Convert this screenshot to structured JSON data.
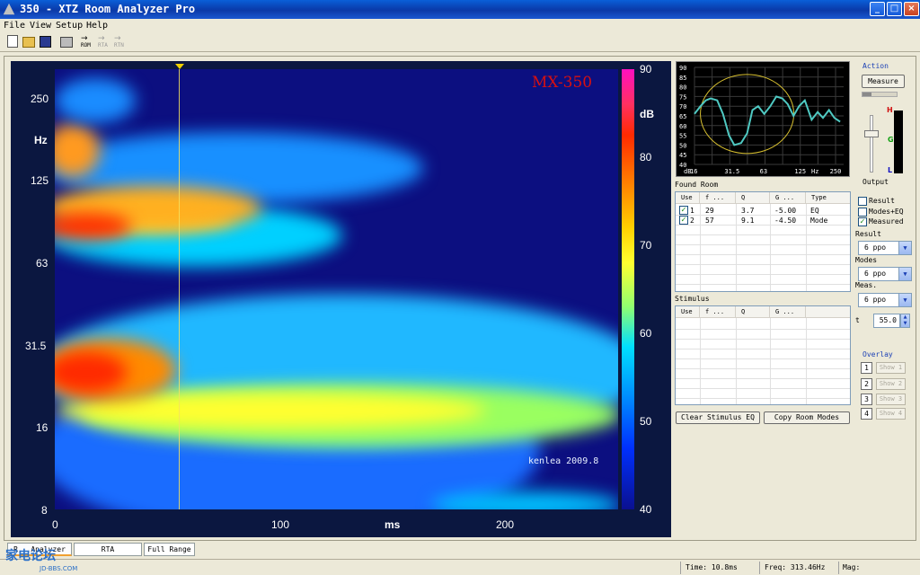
{
  "window": {
    "title": "350 - XTZ Room Analyzer Pro"
  },
  "menu": [
    "File",
    "View",
    "Setup",
    "Help"
  ],
  "toolbar": {
    "rom_label": "ROM",
    "rta_label": "RTA",
    "rtn_label": "RTN"
  },
  "spectrogram": {
    "overlay_title": "MX-350",
    "y_unit": "Hz",
    "y_ticks": [
      "250",
      "125",
      "63",
      "31.5",
      "16",
      "8"
    ],
    "x_ticks": [
      "0",
      "100",
      "200"
    ],
    "x_unit": "ms",
    "colorbar_ticks": [
      "90",
      "80",
      "70",
      "60",
      "50",
      "40"
    ],
    "colorbar_unit": "dB",
    "watermark": "kenlea 2009.8",
    "colors": {
      "background": "#0b1740",
      "cursor": "#f0d000"
    }
  },
  "chart_data": {
    "type": "line",
    "x_ticks": [
      "16",
      "31.5",
      "63",
      "125",
      "250"
    ],
    "y_ticks": [
      "90",
      "85",
      "80",
      "75",
      "70",
      "65",
      "60",
      "55",
      "50",
      "45",
      "40"
    ],
    "y_unit": "dB",
    "x_unit": "Hz",
    "ylim": [
      40,
      90
    ],
    "x": [
      16,
      18,
      20,
      22,
      25,
      28,
      31.5,
      35,
      40,
      45,
      50,
      56,
      63,
      71,
      80,
      90,
      100,
      112,
      125,
      140,
      160,
      180,
      200,
      225,
      250,
      280
    ],
    "values": [
      66,
      70,
      73,
      74,
      73,
      66,
      55,
      50,
      51,
      56,
      68,
      70,
      66,
      70,
      75,
      74,
      71,
      65,
      70,
      73,
      63,
      67,
      64,
      68,
      64,
      62
    ],
    "series_color": "#4fc9c2",
    "ellipse_color": "#d8c030",
    "grid": true
  },
  "found_room": {
    "title": "Found Room",
    "columns": [
      "Use",
      "f ...",
      "Q",
      "G ...",
      "Type"
    ],
    "rows": [
      {
        "use": "1",
        "f": "29",
        "q": "3.7",
        "g": "-5.00",
        "type": "EQ"
      },
      {
        "use": "2",
        "f": "57",
        "q": "9.1",
        "g": "-4.50",
        "type": "Mode"
      }
    ]
  },
  "stimulus": {
    "title": "Stimulus",
    "columns": [
      "Use",
      "f ...",
      "Q",
      "G ..."
    ]
  },
  "buttons": {
    "clear_stimulus": "Clear Stimulus EQ",
    "copy_room": "Copy Room Modes",
    "measure": "Measure"
  },
  "action": {
    "title": "Action",
    "output_label": "Output",
    "meter_h": "H",
    "meter_g": "G",
    "meter_l": "L"
  },
  "display": {
    "result": "Result",
    "modes_eq": "Modes+EQ",
    "measured": "Measured",
    "result_group": "Result",
    "modes_group": "Modes",
    "meas_group": "Meas.",
    "result_value": "6 ppo",
    "modes_value": "6 ppo",
    "meas_value": "6 ppo",
    "t_label": "t",
    "t_value": "55.0"
  },
  "overlay": {
    "title": "Overlay",
    "items": [
      {
        "num": "1",
        "label": "Show 1"
      },
      {
        "num": "2",
        "label": "Show 2"
      },
      {
        "num": "3",
        "label": "Show 3"
      },
      {
        "num": "4",
        "label": "Show 4"
      }
    ]
  },
  "tabs": [
    "R...Analyzer",
    "RTA",
    "Full Range"
  ],
  "status": {
    "time": "Time: 10.8ms",
    "freq": "Freq: 313.46Hz",
    "mag": "Mag:"
  },
  "site_watermark": {
    "main": "家电论坛",
    "sub": "JD-BBS.COM"
  }
}
